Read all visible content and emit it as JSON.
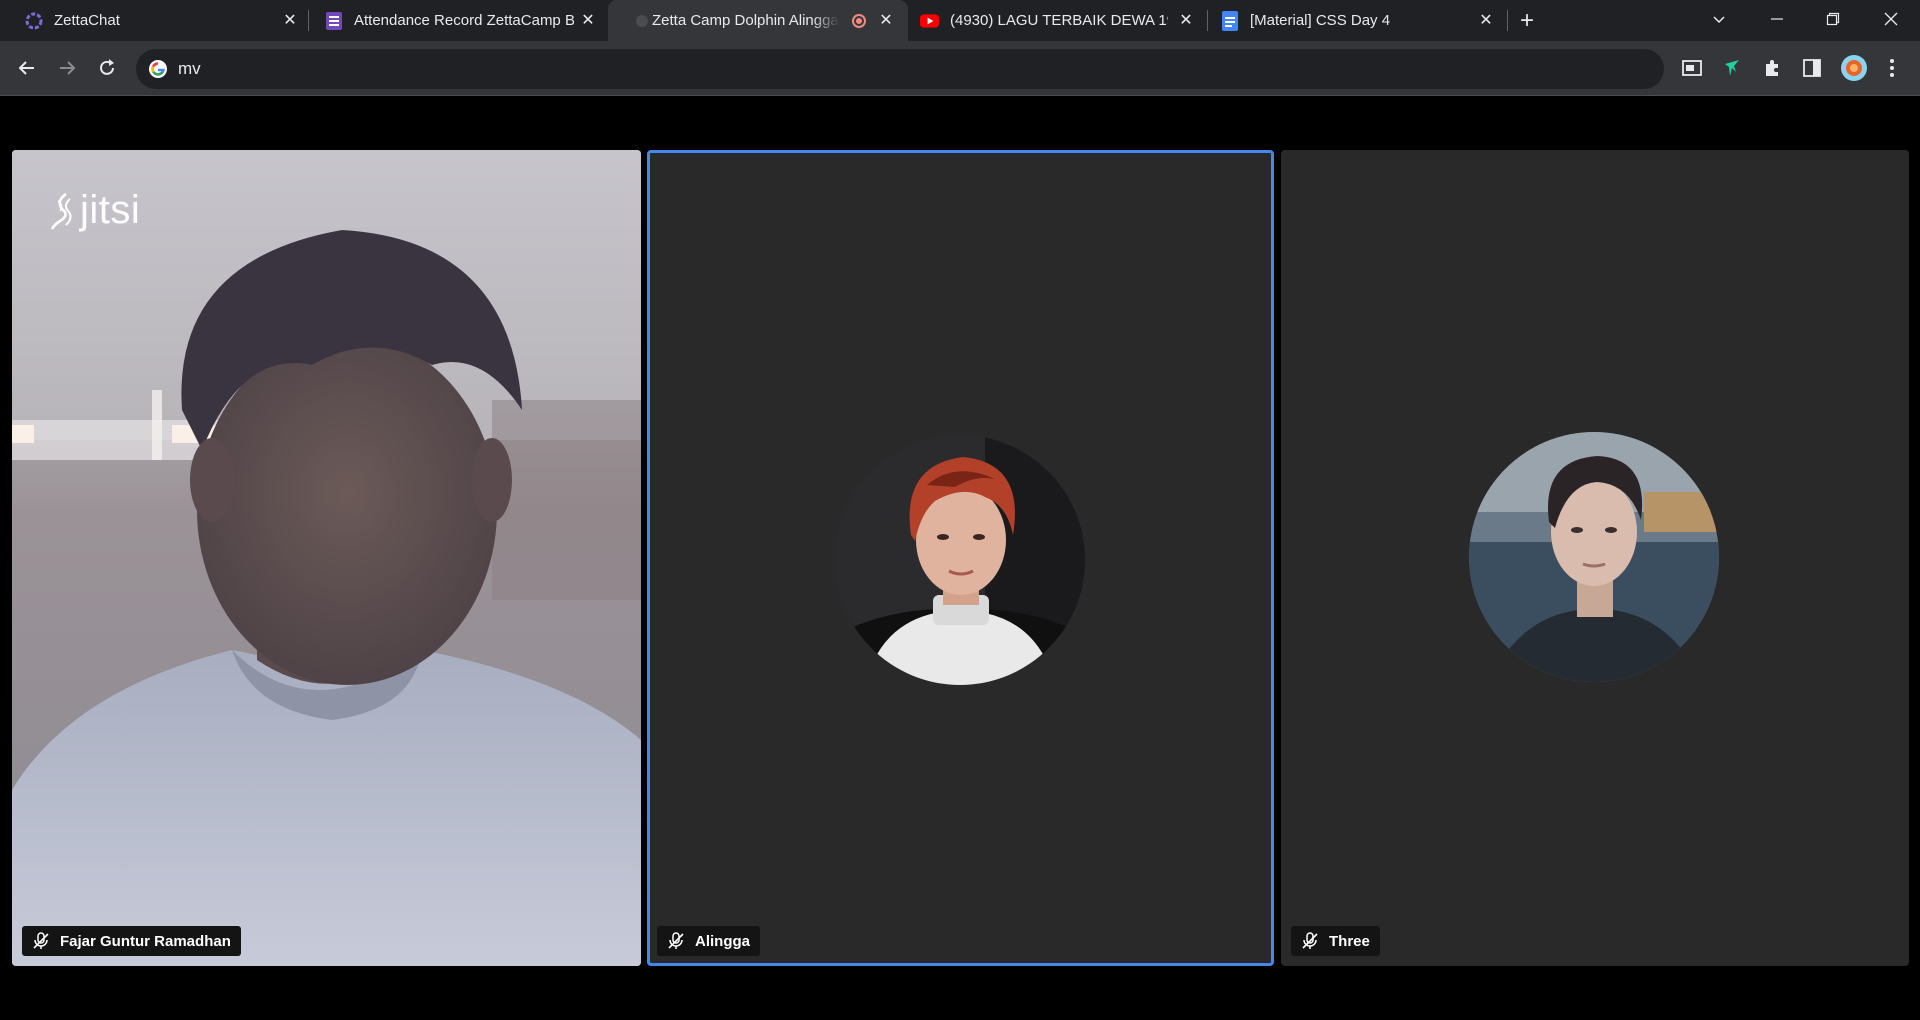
{
  "browser": {
    "tabs": [
      {
        "title": "ZettaChat",
        "icon": "zettachat-icon"
      },
      {
        "title": "Attendance Record ZettaCamp B",
        "icon": "forms-icon"
      },
      {
        "title": "Zetta Camp Dolphin Alingga",
        "icon": "jitsi-icon",
        "active": true,
        "recording": true
      },
      {
        "title": "(4930) LAGU TERBAIK DEWA 19 -",
        "icon": "youtube-icon"
      },
      {
        "title": "[Material] CSS Day 4",
        "icon": "docs-icon"
      }
    ],
    "address": "mv",
    "colors": {
      "tabstrip": "#202124",
      "toolbar": "#35363a",
      "accent": "#4687ed"
    }
  },
  "meeting": {
    "logo_text": "jitsi",
    "participants": [
      {
        "name": "Fajar Guntur Ramadhan",
        "muted": true,
        "video": true
      },
      {
        "name": "Alingga",
        "muted": true,
        "video": false,
        "dominant_speaker": true
      },
      {
        "name": "Three",
        "muted": true,
        "video": false
      }
    ]
  }
}
